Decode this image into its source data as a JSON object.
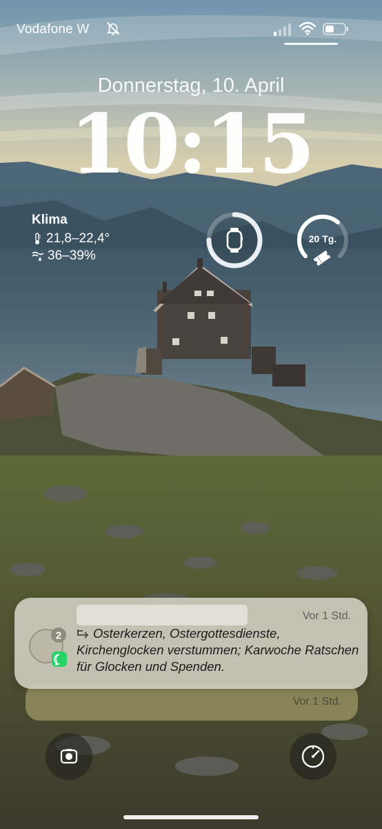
{
  "status_bar": {
    "carrier": "Vodafone W",
    "icons": [
      "bell-slash-icon",
      "signal-icon",
      "wifi-icon",
      "battery-icon"
    ]
  },
  "lock_screen": {
    "date": "Donnerstag, 10. April",
    "time": "10:15"
  },
  "widgets": {
    "weather": {
      "title": "Klima",
      "temperature": "21,8–22,4°",
      "humidity": "36–39%",
      "icons": [
        "thermometer-icon",
        "humidity-icon"
      ]
    },
    "watch_battery": {
      "icon": "apple-watch-icon",
      "level": 0.75
    },
    "countdown": {
      "label": "20 Tg.",
      "icon": "ticket-icon",
      "level": 0.65
    }
  },
  "notifications": [
    {
      "app": "WhatsApp",
      "badge": "2",
      "timestamp": "Vor 1 Std.",
      "message": "Osterkerzen, Ostergottesdienste, Kirchenglocken verstummen; Karwoche Ratschen für Glocken und Spenden."
    },
    {
      "timestamp": "Vor 1 Std."
    }
  ],
  "bottom_buttons": {
    "left": "camera-icon",
    "right": "timer-icon"
  },
  "colors": {
    "whatsapp_green": "#25D366",
    "notification_bg": "#D4D0C4",
    "ring_track": "#9AA3AA"
  }
}
